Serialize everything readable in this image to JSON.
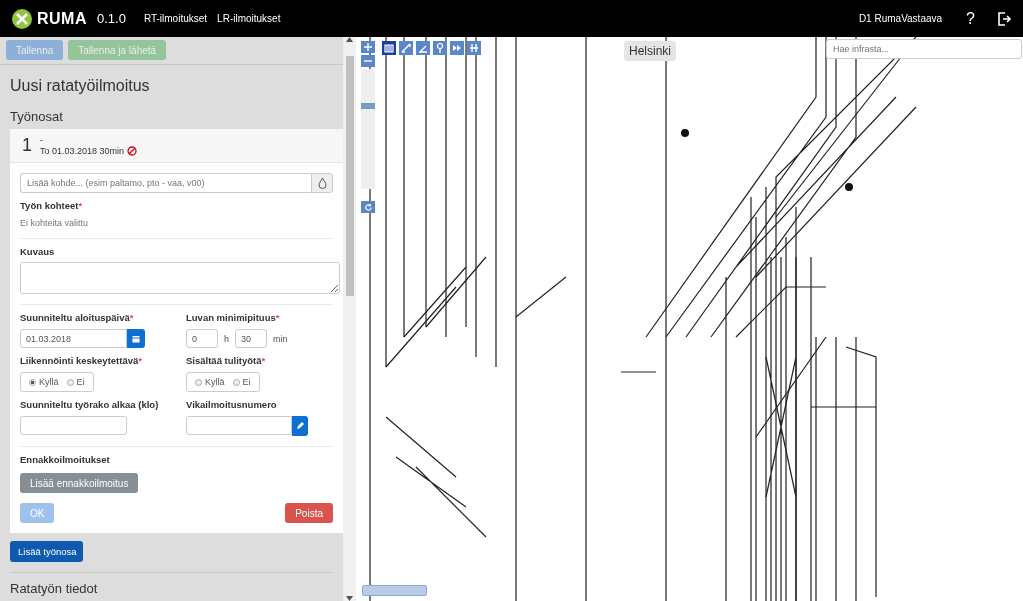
{
  "header": {
    "logo": "RUMA",
    "version": "0.1.0",
    "nav": [
      {
        "label": "RT-ilmoitukset"
      },
      {
        "label": "LR-ilmoitukset"
      }
    ],
    "user": "D1 RumaVastaava",
    "help": "?"
  },
  "toolbar": [
    {
      "label": "Tallenna",
      "kind": "primary",
      "disabled": true
    },
    {
      "label": "Tallenna ja lähetä",
      "kind": "success",
      "disabled": true
    }
  ],
  "title": "Uusi ratatyöilmoitus",
  "section": "Työnosat",
  "work_part": {
    "number": "1",
    "name": "-",
    "summary": "To 01.03.2018 30min",
    "target_placeholder": "Lisää kohde... (esim paltamo, pto - vaa, v00)",
    "targets": {
      "label": "Työn kohteet",
      "required_mark": "*",
      "empty": "Ei kohteita valittu"
    },
    "description": {
      "label": "Kuvaus"
    },
    "start_date": {
      "label": "Suunniteltu aloituspäivä",
      "required_mark": "*",
      "value": "01.03.2018"
    },
    "min_duration": {
      "label": "Luvan minimipituus",
      "required_mark": "*",
      "hours": "0",
      "hours_unit": "h",
      "minutes": "30",
      "minutes_unit": "min"
    },
    "traffic_stop": {
      "label": "Liikennöinti keskeytettävä",
      "required_mark": "*",
      "options": [
        {
          "label": "Kyllä",
          "selected": true
        },
        {
          "label": "Ei",
          "selected": false
        }
      ]
    },
    "hot_work": {
      "label": "Sisältää tulityötä",
      "required_mark": "*",
      "options": [
        {
          "label": "Kyllä",
          "selected": false
        },
        {
          "label": "Ei",
          "selected": false
        }
      ]
    },
    "gap_start": {
      "label": "Suunniteltu työrako alkaa (klo)"
    },
    "fault_number": {
      "label": "Vikailmoitusnumero"
    },
    "advance": {
      "label": "Ennakkoilmoitukset",
      "button": "Lisää ennakkoilmoitus"
    },
    "ok": {
      "label": "OK",
      "disabled": true
    },
    "delete": {
      "label": "Poista"
    }
  },
  "add_part": "Lisää työnosa",
  "next_section": "Ratatyön tiedot",
  "map": {
    "zoom": {
      "level": 0.7
    },
    "search_placeholder": "Hae infrasta...",
    "place_label": "Helsinki",
    "layers": [
      {
        "selected": true
      },
      {
        "selected": false
      },
      {
        "selected": false
      },
      {
        "selected": false
      },
      {
        "selected": false
      },
      {
        "selected": false
      }
    ]
  }
}
